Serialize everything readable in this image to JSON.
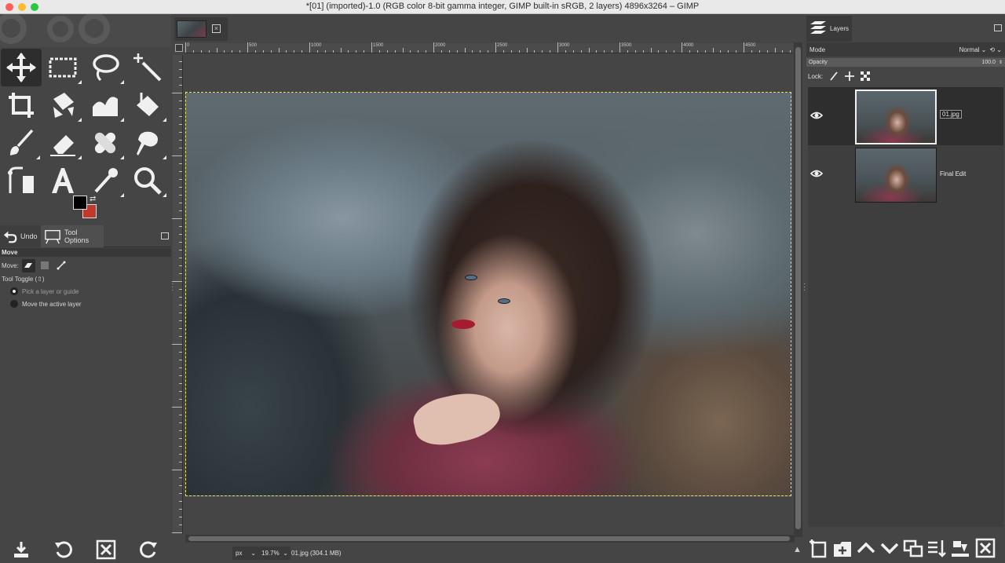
{
  "window": {
    "title": "*[01] (imported)-1.0 (RGB color 8-bit gamma integer, GIMP built-in sRGB, 2 layers) 4896x3264 – GIMP"
  },
  "toolbox": {
    "tools": [
      {
        "name": "move-tool",
        "icon": "move-icon",
        "active": true
      },
      {
        "name": "rect-select-tool",
        "icon": "rect-select-icon"
      },
      {
        "name": "lasso-tool",
        "icon": "lasso-icon"
      },
      {
        "name": "fuzzy-select-tool",
        "icon": "magic-wand-icon"
      },
      {
        "name": "crop-tool",
        "icon": "crop-icon"
      },
      {
        "name": "transform-tool",
        "icon": "transform-icon"
      },
      {
        "name": "warp-tool",
        "icon": "warp-icon"
      },
      {
        "name": "bucket-fill-tool",
        "icon": "bucket-icon"
      },
      {
        "name": "paintbrush-tool",
        "icon": "paintbrush-icon"
      },
      {
        "name": "eraser-tool",
        "icon": "eraser-icon"
      },
      {
        "name": "heal-tool",
        "icon": "bandage-icon"
      },
      {
        "name": "smudge-tool",
        "icon": "smudge-icon"
      },
      {
        "name": "paths-tool",
        "icon": "paths-icon"
      },
      {
        "name": "text-tool",
        "icon": "text-icon",
        "glyph": "A"
      },
      {
        "name": "color-picker-tool",
        "icon": "eyedropper-icon"
      },
      {
        "name": "zoom-tool",
        "icon": "zoom-icon"
      }
    ],
    "foreground_color": "#000000",
    "background_color": "#c0392b"
  },
  "left_tabs": {
    "undo_label": "Undo",
    "tool_options_label": "Tool Options"
  },
  "tool_options": {
    "header": "Move",
    "move_label": "Move:",
    "tool_toggle_label": "Tool Toggle  (⇧)",
    "option_pick": "Pick a layer or guide",
    "option_move_active": "Move the active layer"
  },
  "canvas": {
    "ruler_labels": [
      "0",
      "500",
      "1000",
      "1500",
      "2000",
      "2500",
      "3000",
      "3500",
      "4000",
      "4500"
    ],
    "selection_color": "#e6e36a"
  },
  "statusbar": {
    "unit": "px",
    "zoom": "19.7%",
    "info": "01.jpg (304.1 MB)"
  },
  "layers_panel": {
    "tab_label": "Layers",
    "mode_label": "Mode",
    "mode_value": "Normal",
    "opacity_label": "Opacity",
    "opacity_value": "100.0",
    "lock_label": "Lock:",
    "layers": [
      {
        "name": "01.jpg",
        "visible": true,
        "selected": true
      },
      {
        "name": "Final Edit",
        "visible": true,
        "selected": false
      }
    ]
  }
}
